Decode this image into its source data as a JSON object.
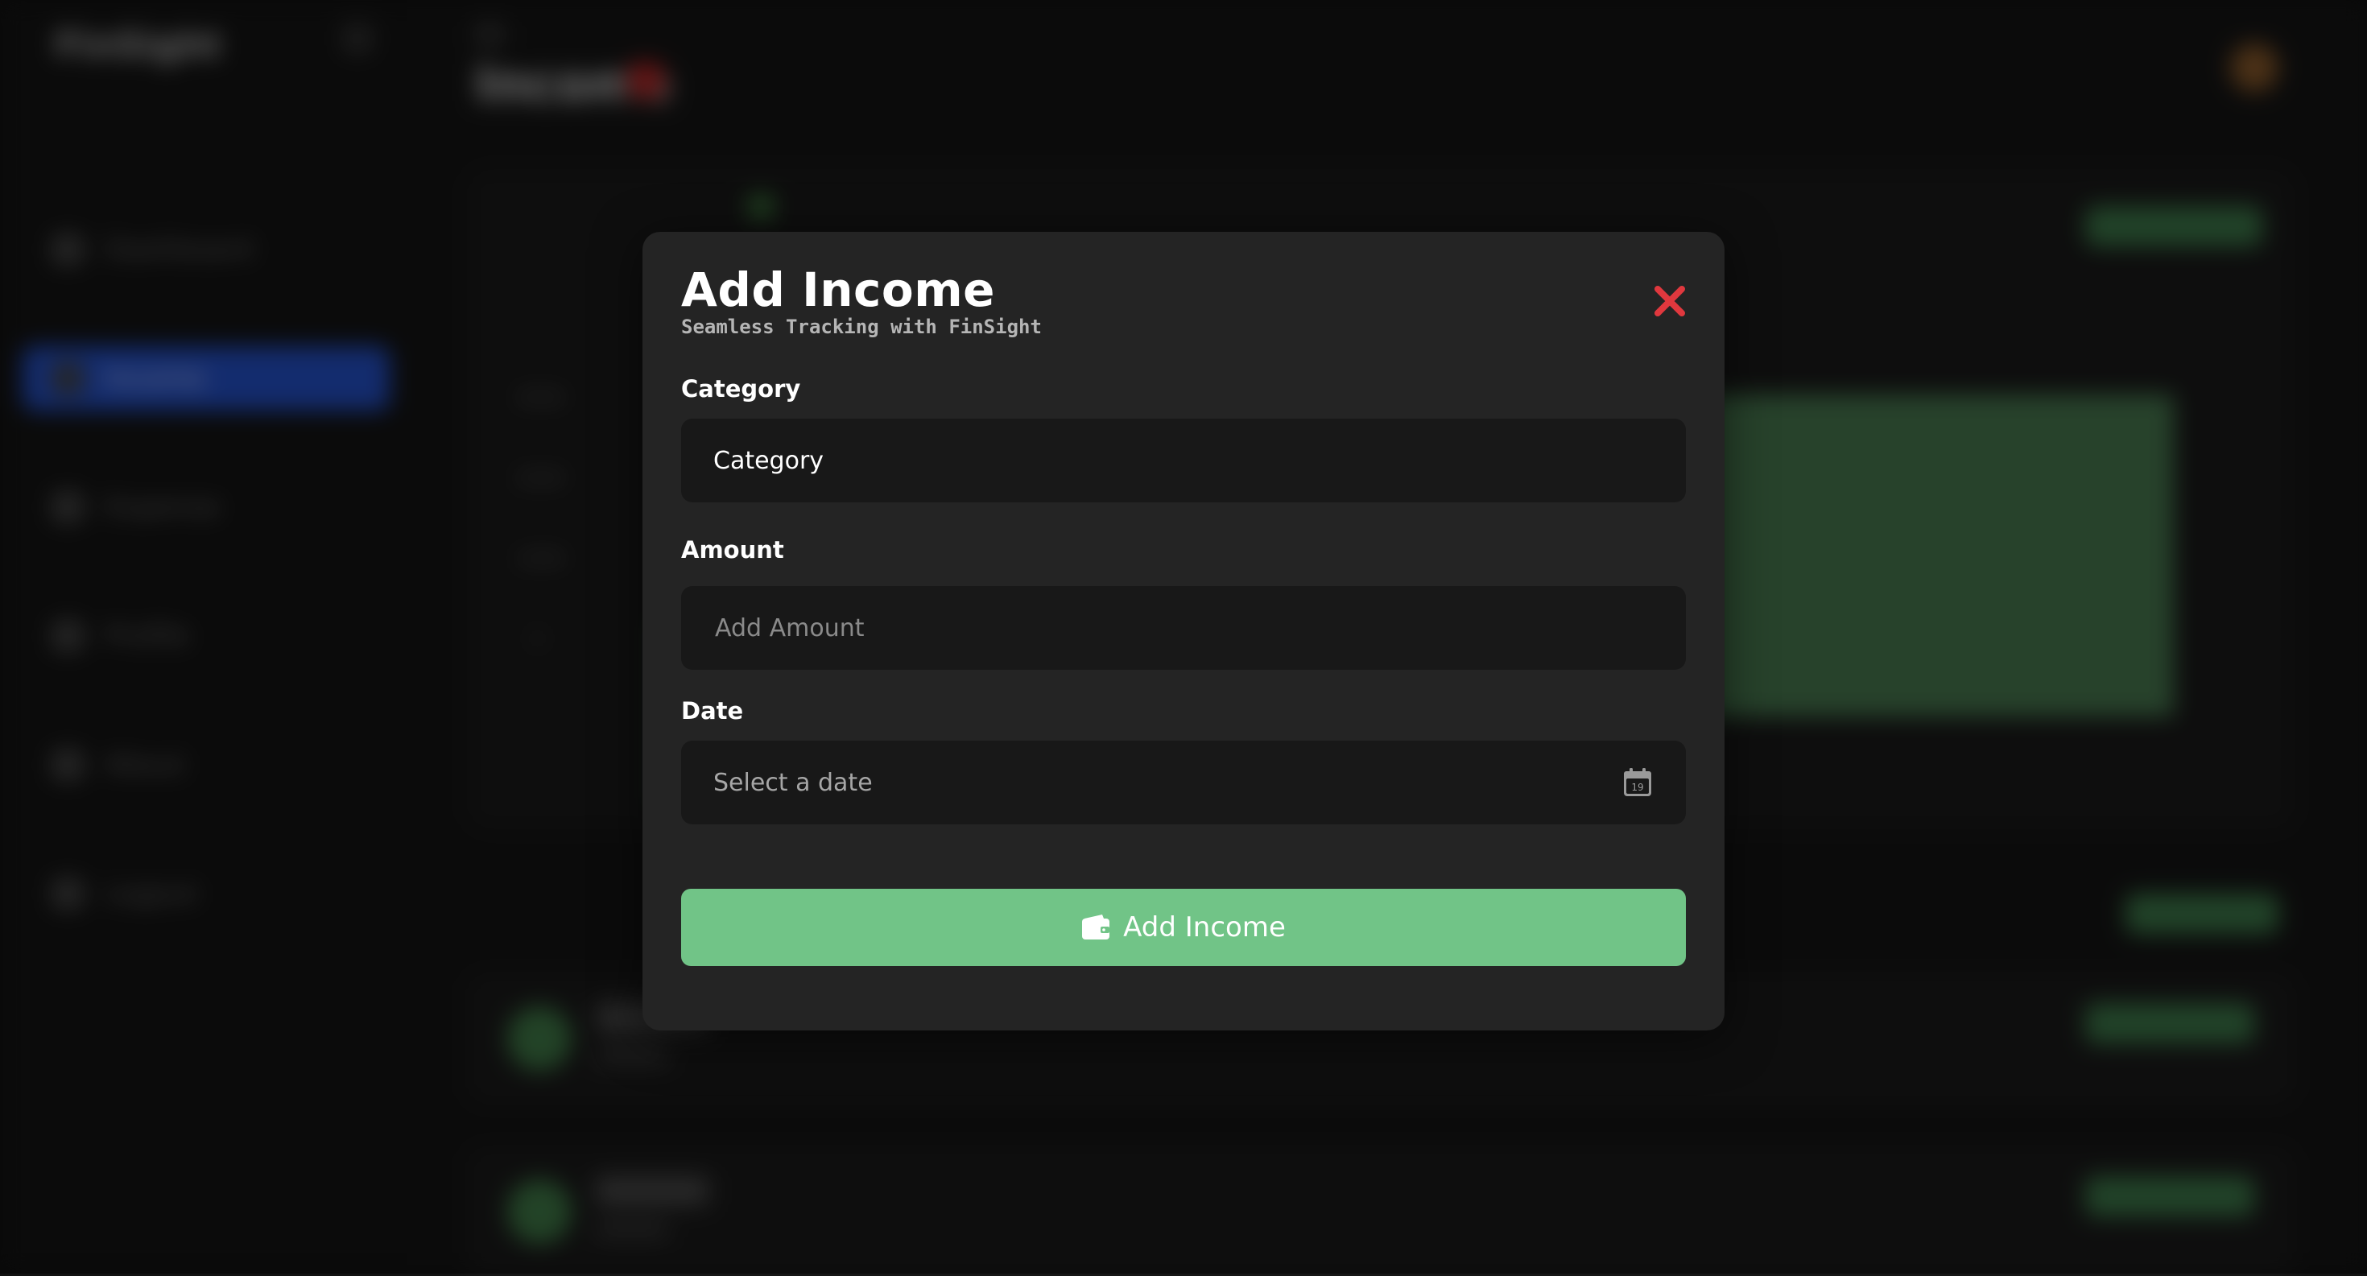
{
  "background": {
    "app_name": "FinSight",
    "page_title": "Income",
    "nav_items": [
      "Dashboard",
      "Income",
      "Expense",
      "Profile",
      "About",
      "Logout"
    ],
    "active_nav_index": 1,
    "chart_yticks": [
      "3000",
      "2000",
      "1000",
      "0"
    ]
  },
  "modal": {
    "title": "Add Income",
    "subtitle": "Seamless Tracking with FinSight",
    "close_icon": "close-x-icon",
    "fields": {
      "category": {
        "label": "Category",
        "value": "Category"
      },
      "amount": {
        "label": "Amount",
        "placeholder": "Add Amount"
      },
      "date": {
        "label": "Date",
        "placeholder": "Select a date",
        "calendar_day": "19"
      }
    },
    "submit": {
      "label": "Add Income",
      "icon": "wallet-icon"
    }
  },
  "colors": {
    "accent_green": "#71c487",
    "close_red": "#e0383e",
    "modal_bg": "#242424",
    "field_bg": "#181818",
    "sidebar_active": "#2450c8"
  }
}
